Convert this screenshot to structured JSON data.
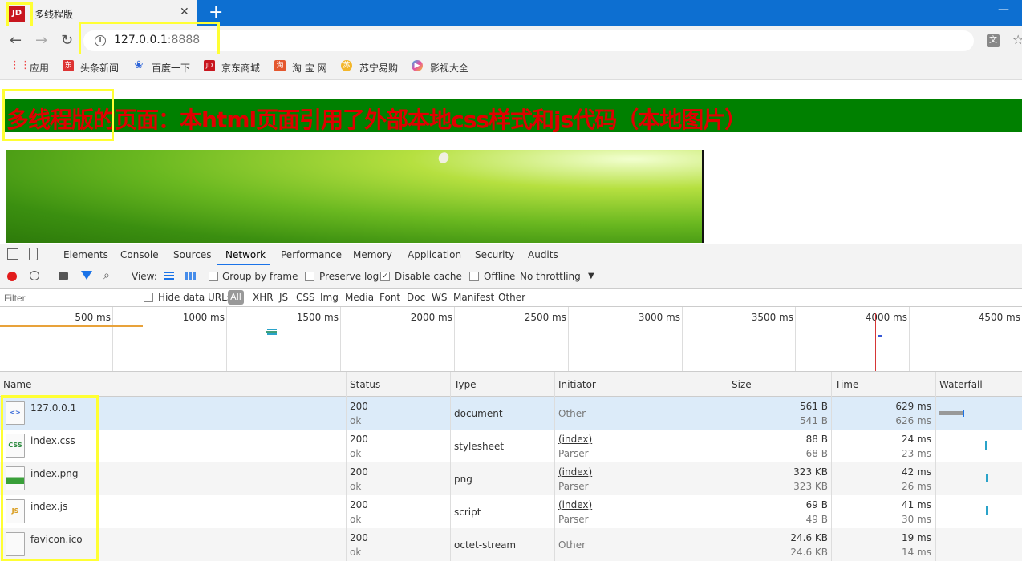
{
  "browser": {
    "tab": {
      "favicon_text": "JD",
      "title": "多线程版"
    },
    "new_tab_label": "+",
    "minimize_label": "—",
    "close_label": "✕",
    "url_host": "127.0.0.1",
    "url_port": ":8888",
    "bookmarks": [
      "应用",
      "头条新闻",
      "百度一下",
      "京东商城",
      "淘 宝 网",
      "苏宁易购",
      "影视大全"
    ]
  },
  "page": {
    "title": "多线程版的页面：本html页面引用了外部本地css样式和js代码（本地图片）"
  },
  "devtools": {
    "tabs": [
      "Elements",
      "Console",
      "Sources",
      "Network",
      "Performance",
      "Memory",
      "Application",
      "Security",
      "Audits"
    ],
    "active_tab": "Network",
    "toolbar": {
      "view_label": "View:",
      "group_by_frame": "Group by frame",
      "preserve_log": "Preserve log",
      "disable_cache": "Disable cache",
      "offline": "Offline",
      "throttling": "No throttling"
    },
    "filter": {
      "placeholder": "Filter",
      "hide_data_urls": "Hide data URLs",
      "types": [
        "All",
        "XHR",
        "JS",
        "CSS",
        "Img",
        "Media",
        "Font",
        "Doc",
        "WS",
        "Manifest",
        "Other"
      ]
    },
    "overview_ticks": [
      "500 ms",
      "1000 ms",
      "1500 ms",
      "2000 ms",
      "2500 ms",
      "3000 ms",
      "3500 ms",
      "4000 ms",
      "4500 ms"
    ],
    "columns": [
      "Name",
      "Status",
      "Type",
      "Initiator",
      "Size",
      "Time",
      "Waterfall"
    ],
    "rows": [
      {
        "name": "127.0.0.1",
        "icon": "document-icon",
        "icon_text": "<>",
        "status": "200",
        "status_text": "ok",
        "type": "document",
        "initiator": "Other",
        "initiator_sub": "",
        "size": "561 B",
        "size_sub": "541 B",
        "time": "629 ms",
        "time_sub": "626 ms"
      },
      {
        "name": "index.css",
        "icon": "css-icon",
        "icon_text": "CSS",
        "status": "200",
        "status_text": "ok",
        "type": "stylesheet",
        "initiator": "(index)",
        "initiator_sub": "Parser",
        "size": "88 B",
        "size_sub": "68 B",
        "time": "24 ms",
        "time_sub": "23 ms"
      },
      {
        "name": "index.png",
        "icon": "image-icon",
        "icon_text": "",
        "status": "200",
        "status_text": "ok",
        "type": "png",
        "initiator": "(index)",
        "initiator_sub": "Parser",
        "size": "323 KB",
        "size_sub": "323 KB",
        "time": "42 ms",
        "time_sub": "26 ms"
      },
      {
        "name": "index.js",
        "icon": "js-icon",
        "icon_text": "JS",
        "status": "200",
        "status_text": "ok",
        "type": "script",
        "initiator": "(index)",
        "initiator_sub": "Parser",
        "size": "69 B",
        "size_sub": "49 B",
        "time": "41 ms",
        "time_sub": "30 ms"
      },
      {
        "name": "favicon.ico",
        "icon": "blank-file-icon",
        "icon_text": "",
        "status": "200",
        "status_text": "ok",
        "type": "octet-stream",
        "initiator": "Other",
        "initiator_sub": "",
        "size": "24.6 KB",
        "size_sub": "24.6 KB",
        "time": "19 ms",
        "time_sub": "14 ms"
      }
    ]
  },
  "colors": {
    "tabstrip": "#0d6fd1",
    "page_header_bg": "#008000",
    "page_title": "#e00000",
    "highlight": "#ffff33",
    "selected_row": "#dcebf9"
  }
}
